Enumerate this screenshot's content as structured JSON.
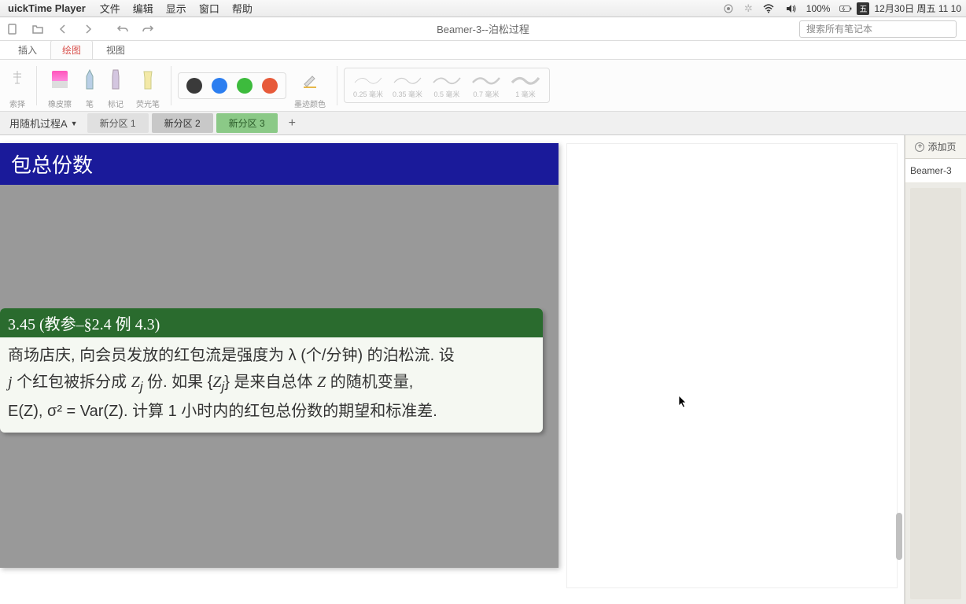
{
  "menubar": {
    "app": "uickTime Player",
    "items": [
      "文件",
      "编辑",
      "显示",
      "窗口",
      "帮助"
    ],
    "battery": "100%",
    "date": "12月30日 周五 11 10",
    "ime": "五"
  },
  "toolbar": {
    "title": "Beamer-3--泊松过程",
    "search_placeholder": "搜索所有笔记本"
  },
  "ribbon_tabs": {
    "insert": "插入",
    "draw": "绘图",
    "view": "视图"
  },
  "ribbon": {
    "select": "索择",
    "eraser": "橡皮擦",
    "pen": "笔",
    "marker": "标记",
    "highlighter": "荧光笔",
    "ink_color": "墨迹颜色",
    "colors": [
      "#3a3a3a",
      "#2c7ef0",
      "#3dbb3d",
      "#e75a3a"
    ],
    "strokes": [
      {
        "label": "0.25 毫米",
        "w": 0.8
      },
      {
        "label": "0.35 毫米",
        "w": 1.2
      },
      {
        "label": "0.5 毫米",
        "w": 1.8
      },
      {
        "label": "0.7 毫米",
        "w": 2.5
      },
      {
        "label": "1 毫米",
        "w": 3.2
      }
    ]
  },
  "notebook": {
    "name": "用随机过程A",
    "tabs": [
      "新分区 1",
      "新分区 2",
      "新分区 3"
    ]
  },
  "sidebar": {
    "add_page": "添加页",
    "page1": "Beamer-3"
  },
  "slide": {
    "title": "包总份数",
    "example_num": "3.45 (教参–§2.4 例 4.3)",
    "body_l1": "商场店庆, 向会员发放的红包流是强度为 λ (个/分钟) 的泊松流. 设",
    "body_l2_a": " 个红包被拆分成 ",
    "body_l2_b": " 份. 如果 {",
    "body_l2_c": "} 是来自总体 ",
    "body_l2_d": " 的随机变量,",
    "body_l3": "E(Z), σ² = Var(Z). 计算 1 小时内的红包总份数的期望和标准差."
  }
}
